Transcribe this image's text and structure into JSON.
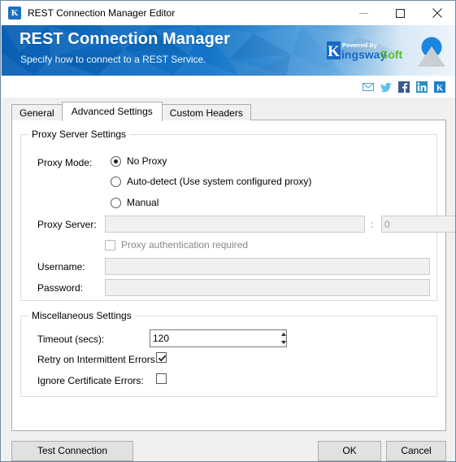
{
  "window": {
    "title": "REST Connection Manager Editor",
    "app_icon": "k-logo-icon",
    "controls": {
      "minimize": "minimize-icon",
      "maximize": "maximize-icon",
      "close": "close-icon"
    }
  },
  "banner": {
    "title": "REST Connection Manager",
    "subtitle": "Specify how to connect to a REST Service.",
    "brand": {
      "powered_by": "Powered By",
      "name_k": "K",
      "name_first": "ingsway",
      "name_second": "Soft"
    },
    "colors": {
      "blue_dark": "#0b63b8",
      "blue_mid": "#1878cc",
      "blue_light": "#d9e8f5",
      "green": "#5ec02a"
    }
  },
  "social": {
    "items": [
      {
        "name": "email-icon",
        "label": "Email"
      },
      {
        "name": "twitter-icon",
        "label": "Twitter"
      },
      {
        "name": "facebook-icon",
        "label": "Facebook"
      },
      {
        "name": "linkedin-icon",
        "label": "LinkedIn"
      },
      {
        "name": "kingswaysoft-icon",
        "label": "KingswaySoft"
      }
    ]
  },
  "tabs": [
    {
      "label": "General",
      "active": false
    },
    {
      "label": "Advanced Settings",
      "active": true
    },
    {
      "label": "Custom Headers",
      "active": false
    }
  ],
  "proxy_group": {
    "title": "Proxy Server Settings",
    "proxy_mode_label": "Proxy Mode:",
    "modes": [
      {
        "label": "No Proxy",
        "checked": true
      },
      {
        "label": "Auto-detect (Use system configured proxy)",
        "checked": false
      },
      {
        "label": "Manual",
        "checked": false
      }
    ],
    "proxy_server_label": "Proxy Server:",
    "proxy_server_value": "",
    "port_separator": ":",
    "port_value": "0",
    "auth_required_label": "Proxy authentication required",
    "auth_required_checked": false,
    "username_label": "Username:",
    "username_value": "",
    "password_label": "Password:",
    "password_value": ""
  },
  "misc_group": {
    "title": "Miscellaneous Settings",
    "timeout_label": "Timeout (secs):",
    "timeout_value": "120",
    "retry_label": "Retry on Intermittent Errors:",
    "retry_checked": true,
    "ignore_cert_label": "Ignore Certificate Errors:",
    "ignore_cert_checked": false
  },
  "footer": {
    "test_connection": "Test Connection",
    "ok": "OK",
    "cancel": "Cancel"
  }
}
